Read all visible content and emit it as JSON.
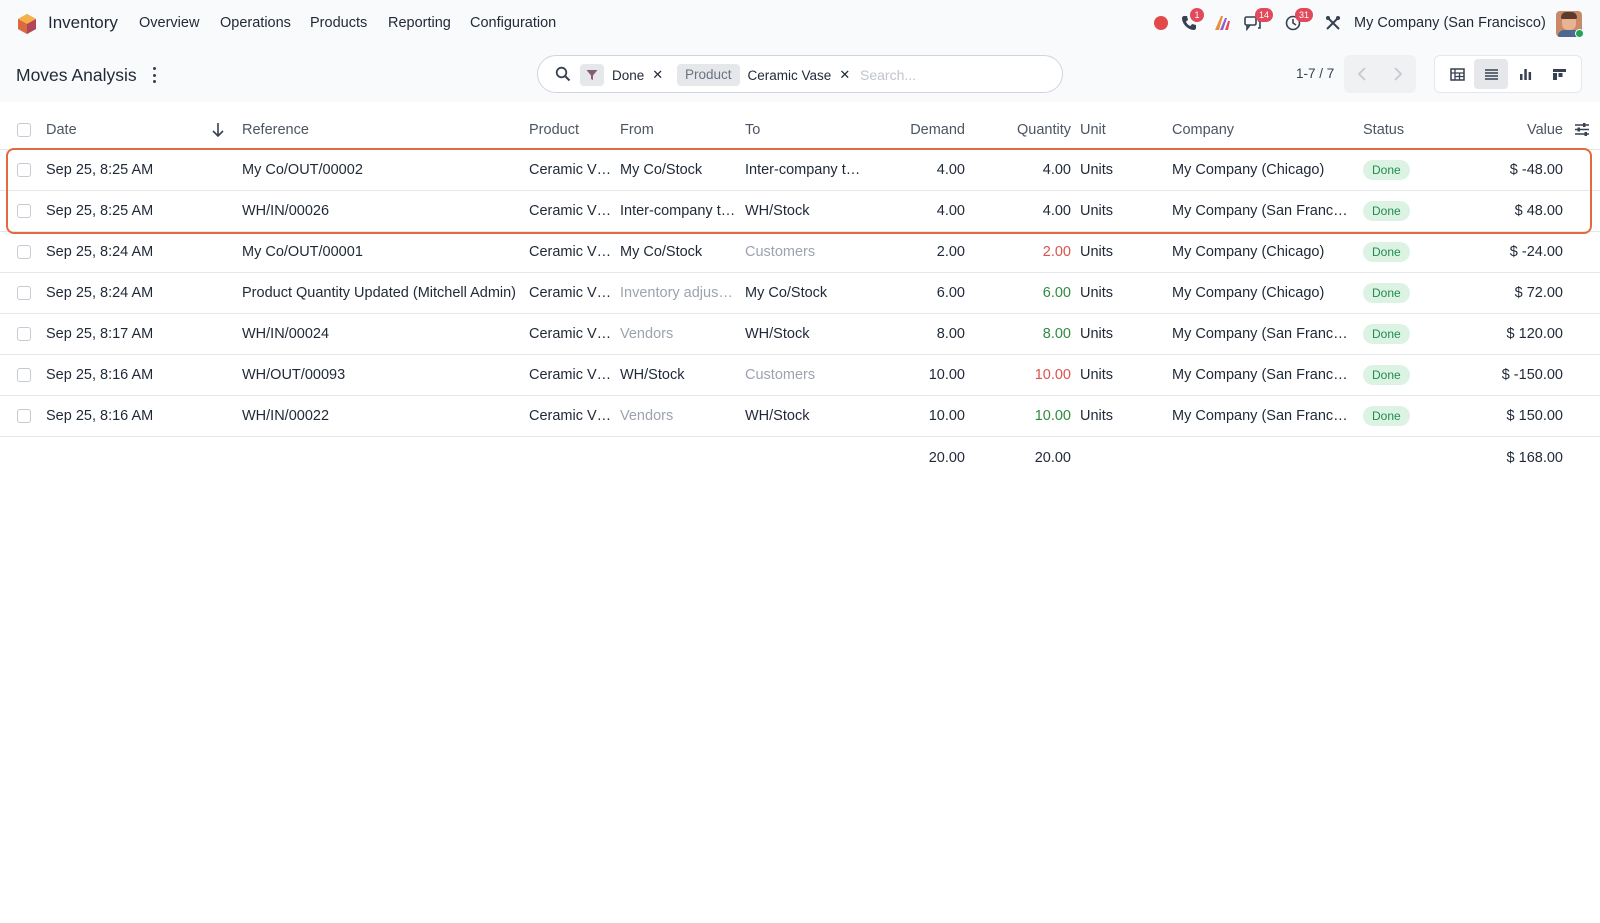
{
  "navbar": {
    "app_name": "Inventory",
    "menus": [
      "Overview",
      "Operations",
      "Products",
      "Reporting",
      "Configuration"
    ],
    "badges": {
      "phone": "1",
      "chat": "14",
      "activity": "31"
    },
    "company": "My Company (San Francisco)",
    "colors": {
      "record_dot": "#e24a4a",
      "badge": "#e2495b"
    }
  },
  "control": {
    "title": "Moves Analysis",
    "filters": {
      "done": "Done",
      "product_label": "Product",
      "product_value": "Ceramic Vase"
    },
    "search_placeholder": "Search...",
    "pager": "1-7 / 7",
    "views": [
      "pivot-icon",
      "list-icon",
      "graph-icon",
      "kanban-icon"
    ],
    "active_view": "list-icon"
  },
  "table": {
    "columns": [
      "Date",
      "Reference",
      "Product",
      "From",
      "To",
      "Demand",
      "Quantity",
      "Unit",
      "Company",
      "Status",
      "Value"
    ],
    "rows": [
      {
        "date": "Sep 25, 8:25 AM",
        "reference": "My Co/OUT/00002",
        "product": "Ceramic V…",
        "from": "My Co/Stock",
        "to": "Inter-company t…",
        "demand": "4.00",
        "quantity": "4.00",
        "unit": "Units",
        "company": "My Company (Chicago)",
        "status": "Done",
        "value": "$ -48.00"
      },
      {
        "date": "Sep 25, 8:25 AM",
        "reference": "WH/IN/00026",
        "product": "Ceramic V…",
        "from": "Inter-company t…",
        "to": "WH/Stock",
        "demand": "4.00",
        "quantity": "4.00",
        "unit": "Units",
        "company": "My Company (San Franci…",
        "status": "Done",
        "value": "$ 48.00"
      },
      {
        "date": "Sep 25, 8:24 AM",
        "reference": "My Co/OUT/00001",
        "product": "Ceramic V…",
        "from": "My Co/Stock",
        "to": "Customers",
        "demand": "2.00",
        "quantity": "2.00",
        "unit": "Units",
        "company": "My Company (Chicago)",
        "status": "Done",
        "value": "$ -24.00"
      },
      {
        "date": "Sep 25, 8:24 AM",
        "reference": "Product Quantity Updated (Mitchell Admin)",
        "product": "Ceramic V…",
        "from": "Inventory adjus…",
        "to": "My Co/Stock",
        "demand": "6.00",
        "quantity": "6.00",
        "unit": "Units",
        "company": "My Company (Chicago)",
        "status": "Done",
        "value": "$ 72.00"
      },
      {
        "date": "Sep 25, 8:17 AM",
        "reference": "WH/IN/00024",
        "product": "Ceramic V…",
        "from": "Vendors",
        "to": "WH/Stock",
        "demand": "8.00",
        "quantity": "8.00",
        "unit": "Units",
        "company": "My Company (San Franci…",
        "status": "Done",
        "value": "$ 120.00"
      },
      {
        "date": "Sep 25, 8:16 AM",
        "reference": "WH/OUT/00093",
        "product": "Ceramic V…",
        "from": "WH/Stock",
        "to": "Customers",
        "demand": "10.00",
        "quantity": "10.00",
        "unit": "Units",
        "company": "My Company (San Franci…",
        "status": "Done",
        "value": "$ -150.00"
      },
      {
        "date": "Sep 25, 8:16 AM",
        "reference": "WH/IN/00022",
        "product": "Ceramic V…",
        "from": "Vendors",
        "to": "WH/Stock",
        "demand": "10.00",
        "quantity": "10.00",
        "unit": "Units",
        "company": "My Company (San Franci…",
        "status": "Done",
        "value": "$ 150.00"
      }
    ],
    "totals": {
      "demand": "20.00",
      "quantity": "20.00",
      "value": "$ 168.00"
    }
  },
  "colors": {
    "highlight_box": "#e36a3e",
    "status_done_bg": "#dcf3e4",
    "quantity_out": "#d9534f",
    "quantity_in": "#2e8b3e"
  }
}
